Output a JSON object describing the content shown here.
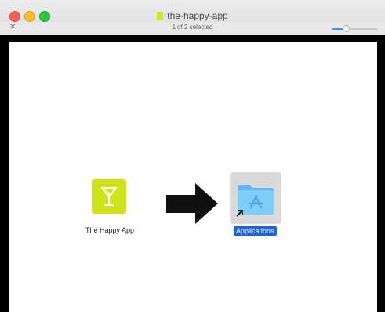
{
  "window": {
    "title": "the-happy-app",
    "status": "1 of 2 selected",
    "icon_size_level": 0.3
  },
  "items": [
    {
      "label": "The Happy App",
      "icon": "cocktail-app-icon",
      "color": "#cfe31b"
    },
    {
      "label": "Applications",
      "icon": "applications-folder-icon",
      "selected": true
    }
  ],
  "colors": {
    "app_icon": "#cfe31b",
    "selection": "#1f63d9",
    "folder": "#6ec4f3"
  }
}
